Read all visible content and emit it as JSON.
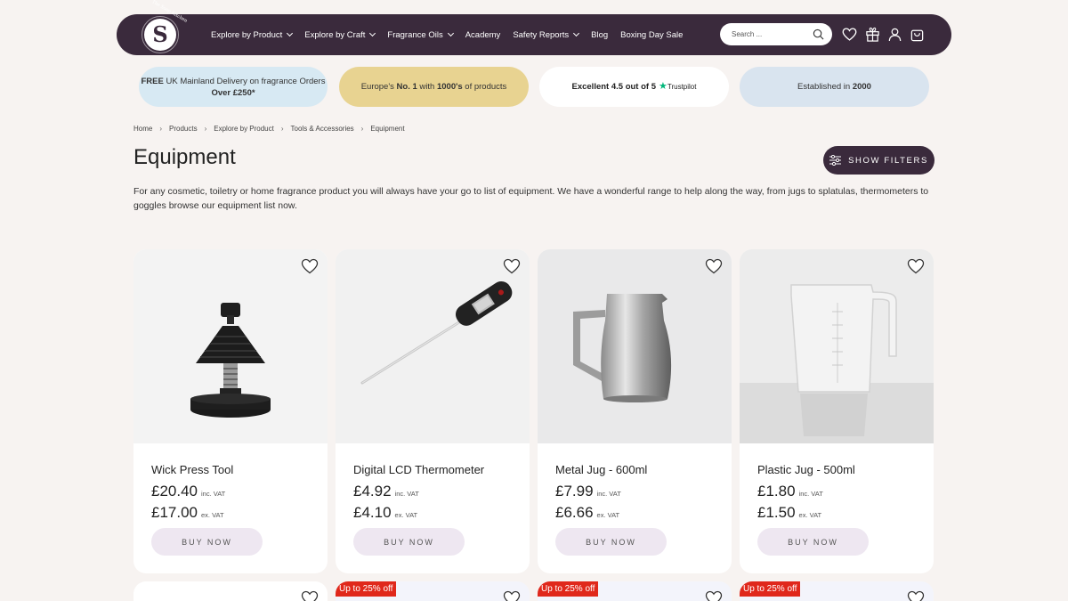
{
  "header": {
    "logo_letter": "S",
    "logo_ring_text": "The Soap Kitchen",
    "nav": [
      {
        "label": "Explore by Product",
        "has_chevron": true
      },
      {
        "label": "Explore by Craft",
        "has_chevron": true
      },
      {
        "label": "Fragrance Oils",
        "has_chevron": true
      },
      {
        "label": "Academy",
        "has_chevron": false
      },
      {
        "label": "Safety Reports",
        "has_chevron": true
      },
      {
        "label": "Blog",
        "has_chevron": false
      },
      {
        "label": "Boxing Day Sale",
        "has_chevron": false
      }
    ],
    "search_placeholder": "Search ...",
    "icons": [
      "heart-icon",
      "gift-icon",
      "user-icon",
      "cart-icon"
    ]
  },
  "banners": {
    "b1": {
      "pre": "FREE",
      "mid": " UK Mainland Delivery on fragrance Orders ",
      "bold": "Over £250*"
    },
    "b2": {
      "pre": "Europe's ",
      "bold1": "No. 1",
      "mid": " with ",
      "bold2": "1000's",
      "post": " of products"
    },
    "b3": {
      "text": "Excellent 4.5 out of 5",
      "brand": "Trustpilot"
    },
    "b4": {
      "pre": "Established in ",
      "bold": "2000"
    }
  },
  "breadcrumb": [
    "Home",
    "Products",
    "Explore by Product",
    "Tools & Accessories",
    "Equipment"
  ],
  "page": {
    "title": "Equipment",
    "filters_label": "SHOW FILTERS",
    "description": "For any cosmetic, toiletry or home fragrance product you will always have your go to list of equipment. We have a wonderful range to help along the way, from jugs to splatulas, thermometers to goggles browse our equipment list now."
  },
  "products": [
    {
      "name": "Wick Press Tool",
      "price_inc": "£20.40",
      "price_ex": "£17.00",
      "inc_label": "inc. VAT",
      "ex_label": "ex. VAT",
      "buy_label": "BUY NOW"
    },
    {
      "name": "Digital LCD Thermometer",
      "price_inc": "£4.92",
      "price_ex": "£4.10",
      "inc_label": "inc. VAT",
      "ex_label": "ex. VAT",
      "buy_label": "BUY NOW"
    },
    {
      "name": "Metal Jug - 600ml",
      "price_inc": "£7.99",
      "price_ex": "£6.66",
      "inc_label": "inc. VAT",
      "ex_label": "ex. VAT",
      "buy_label": "BUY NOW"
    },
    {
      "name": "Plastic Jug - 500ml",
      "price_inc": "£1.80",
      "price_ex": "£1.50",
      "inc_label": "inc. VAT",
      "ex_label": "ex. VAT",
      "buy_label": "BUY NOW"
    }
  ],
  "next_row_badges": [
    "",
    "Up to 25% off",
    "Up to 25% off",
    "Up to 25% off"
  ],
  "colors": {
    "header_bg": "#3a2a3c",
    "page_bg": "#f7f3f1",
    "sale_badge": "#e0281b",
    "buy_button": "#eee7f1"
  }
}
